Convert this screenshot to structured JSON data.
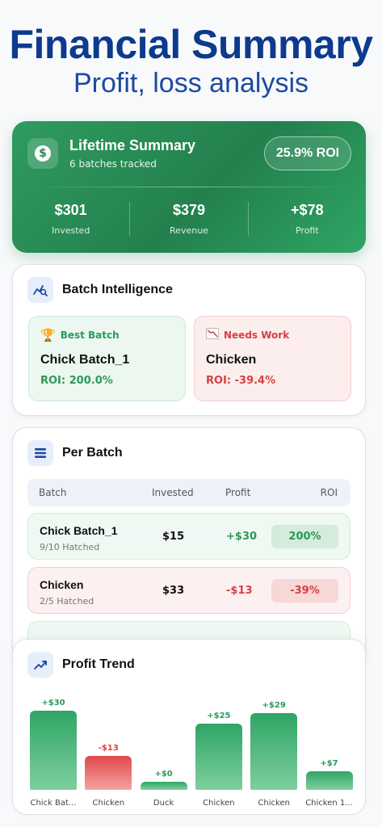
{
  "header": {
    "title": "Financial Summary",
    "subtitle": "Profit, loss analysis"
  },
  "summary": {
    "icon": "dollar-icon",
    "title": "Lifetime Summary",
    "subtitle": "6 batches tracked",
    "roi_badge": "25.9% ROI",
    "stats": [
      {
        "value": "$301",
        "label": "Invested"
      },
      {
        "value": "$379",
        "label": "Revenue"
      },
      {
        "value": "+$78",
        "label": "Profit"
      }
    ]
  },
  "intelligence": {
    "icon": "chart-search-icon",
    "title": "Batch Intelligence",
    "best": {
      "icon": "trophy-icon",
      "label": "Best Batch",
      "name": "Chick Batch_1",
      "roi": "ROI: 200.0%"
    },
    "worst": {
      "icon": "chart-down-icon",
      "label": "Needs Work",
      "name": "Chicken",
      "roi": "ROI: -39.4%"
    }
  },
  "per_batch": {
    "icon": "list-icon",
    "title": "Per Batch",
    "columns": [
      "Batch",
      "Invested",
      "Profit",
      "ROI"
    ],
    "rows": [
      {
        "name": "Chick Batch_1",
        "sub": "9/10 Hatched",
        "invested": "$15",
        "profit": "+$30",
        "roi": "200%",
        "status": "pos"
      },
      {
        "name": "Chicken",
        "sub": "2/5 Hatched",
        "invested": "$33",
        "profit": "-$13",
        "roi": "-39%",
        "status": "neg"
      }
    ]
  },
  "trend": {
    "icon": "trend-up-icon",
    "title": "Profit Trend",
    "colors": {
      "positive": "#2fa565",
      "negative": "#e04848"
    }
  },
  "chart_data": {
    "type": "bar",
    "categories": [
      "Chick Bat...",
      "Chicken",
      "Duck",
      "Chicken",
      "Chicken",
      "Chicken 1..."
    ],
    "values": [
      30,
      -13,
      0,
      25,
      29,
      7
    ],
    "value_labels": [
      "+$30",
      "-$13",
      "+$0",
      "+$25",
      "+$29",
      "+$7"
    ]
  }
}
